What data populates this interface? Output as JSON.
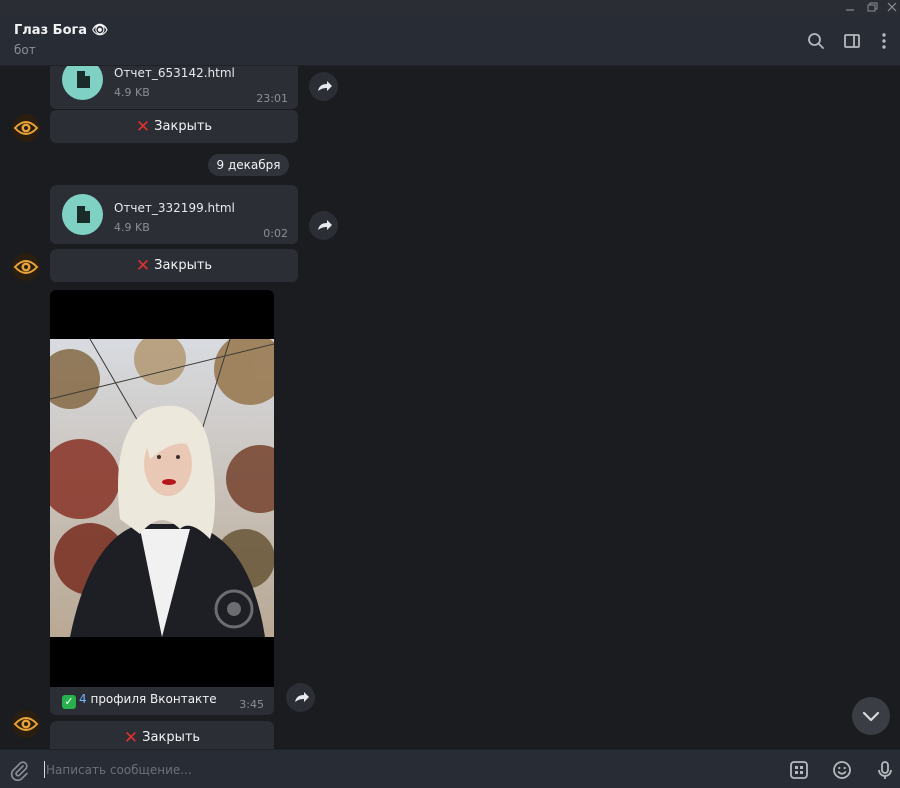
{
  "chat": {
    "title": "Глаз Бога",
    "title_emoji": "👁",
    "subtitle": "бот"
  },
  "messages": [
    {
      "type": "file",
      "file_name": "Отчет_653142.html",
      "size": "4.9 KB",
      "time": "23:01"
    },
    {
      "type": "button",
      "label": "Закрыть"
    },
    {
      "type": "date",
      "label": "9 декабря"
    },
    {
      "type": "file",
      "file_name": "Отчет_332199.html",
      "size": "4.9 KB",
      "time": "0:02"
    },
    {
      "type": "button",
      "label": "Закрыть"
    },
    {
      "type": "photo",
      "caption_number": "4",
      "caption_text": "профиля Вконтакте",
      "time": "3:45"
    },
    {
      "type": "button",
      "label": "Закрыть"
    }
  ],
  "composer": {
    "placeholder": "Написать сообщение..."
  },
  "icons": {
    "window": [
      "minimize-icon",
      "restore-icon",
      "close-icon"
    ],
    "header": [
      "search-icon",
      "side-panel-icon",
      "more-vertical-icon"
    ],
    "composer": [
      "attach-icon",
      "bot-commands-icon",
      "emoji-icon",
      "microphone-icon"
    ]
  },
  "colors": {
    "background": "#1b1c20",
    "bubble": "#2b2e35",
    "header": "#282c34",
    "file_icon": "#7fd1c3",
    "close_x": "#e0312e",
    "check": "#27b04b"
  }
}
